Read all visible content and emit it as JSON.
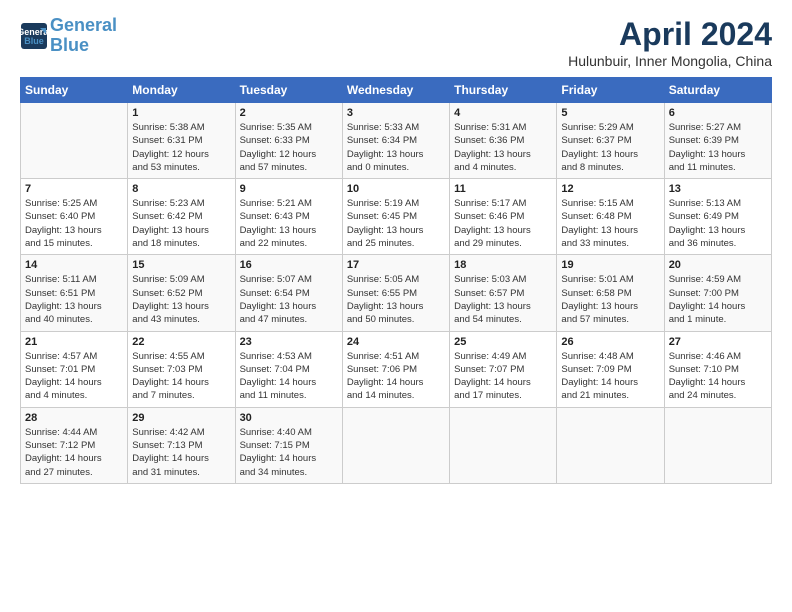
{
  "header": {
    "logo_line1": "General",
    "logo_line2": "Blue",
    "title": "April 2024",
    "location": "Hulunbuir, Inner Mongolia, China"
  },
  "columns": [
    "Sunday",
    "Monday",
    "Tuesday",
    "Wednesday",
    "Thursday",
    "Friday",
    "Saturday"
  ],
  "weeks": [
    [
      {
        "day": "",
        "info": ""
      },
      {
        "day": "1",
        "info": "Sunrise: 5:38 AM\nSunset: 6:31 PM\nDaylight: 12 hours\nand 53 minutes."
      },
      {
        "day": "2",
        "info": "Sunrise: 5:35 AM\nSunset: 6:33 PM\nDaylight: 12 hours\nand 57 minutes."
      },
      {
        "day": "3",
        "info": "Sunrise: 5:33 AM\nSunset: 6:34 PM\nDaylight: 13 hours\nand 0 minutes."
      },
      {
        "day": "4",
        "info": "Sunrise: 5:31 AM\nSunset: 6:36 PM\nDaylight: 13 hours\nand 4 minutes."
      },
      {
        "day": "5",
        "info": "Sunrise: 5:29 AM\nSunset: 6:37 PM\nDaylight: 13 hours\nand 8 minutes."
      },
      {
        "day": "6",
        "info": "Sunrise: 5:27 AM\nSunset: 6:39 PM\nDaylight: 13 hours\nand 11 minutes."
      }
    ],
    [
      {
        "day": "7",
        "info": "Sunrise: 5:25 AM\nSunset: 6:40 PM\nDaylight: 13 hours\nand 15 minutes."
      },
      {
        "day": "8",
        "info": "Sunrise: 5:23 AM\nSunset: 6:42 PM\nDaylight: 13 hours\nand 18 minutes."
      },
      {
        "day": "9",
        "info": "Sunrise: 5:21 AM\nSunset: 6:43 PM\nDaylight: 13 hours\nand 22 minutes."
      },
      {
        "day": "10",
        "info": "Sunrise: 5:19 AM\nSunset: 6:45 PM\nDaylight: 13 hours\nand 25 minutes."
      },
      {
        "day": "11",
        "info": "Sunrise: 5:17 AM\nSunset: 6:46 PM\nDaylight: 13 hours\nand 29 minutes."
      },
      {
        "day": "12",
        "info": "Sunrise: 5:15 AM\nSunset: 6:48 PM\nDaylight: 13 hours\nand 33 minutes."
      },
      {
        "day": "13",
        "info": "Sunrise: 5:13 AM\nSunset: 6:49 PM\nDaylight: 13 hours\nand 36 minutes."
      }
    ],
    [
      {
        "day": "14",
        "info": "Sunrise: 5:11 AM\nSunset: 6:51 PM\nDaylight: 13 hours\nand 40 minutes."
      },
      {
        "day": "15",
        "info": "Sunrise: 5:09 AM\nSunset: 6:52 PM\nDaylight: 13 hours\nand 43 minutes."
      },
      {
        "day": "16",
        "info": "Sunrise: 5:07 AM\nSunset: 6:54 PM\nDaylight: 13 hours\nand 47 minutes."
      },
      {
        "day": "17",
        "info": "Sunrise: 5:05 AM\nSunset: 6:55 PM\nDaylight: 13 hours\nand 50 minutes."
      },
      {
        "day": "18",
        "info": "Sunrise: 5:03 AM\nSunset: 6:57 PM\nDaylight: 13 hours\nand 54 minutes."
      },
      {
        "day": "19",
        "info": "Sunrise: 5:01 AM\nSunset: 6:58 PM\nDaylight: 13 hours\nand 57 minutes."
      },
      {
        "day": "20",
        "info": "Sunrise: 4:59 AM\nSunset: 7:00 PM\nDaylight: 14 hours\nand 1 minute."
      }
    ],
    [
      {
        "day": "21",
        "info": "Sunrise: 4:57 AM\nSunset: 7:01 PM\nDaylight: 14 hours\nand 4 minutes."
      },
      {
        "day": "22",
        "info": "Sunrise: 4:55 AM\nSunset: 7:03 PM\nDaylight: 14 hours\nand 7 minutes."
      },
      {
        "day": "23",
        "info": "Sunrise: 4:53 AM\nSunset: 7:04 PM\nDaylight: 14 hours\nand 11 minutes."
      },
      {
        "day": "24",
        "info": "Sunrise: 4:51 AM\nSunset: 7:06 PM\nDaylight: 14 hours\nand 14 minutes."
      },
      {
        "day": "25",
        "info": "Sunrise: 4:49 AM\nSunset: 7:07 PM\nDaylight: 14 hours\nand 17 minutes."
      },
      {
        "day": "26",
        "info": "Sunrise: 4:48 AM\nSunset: 7:09 PM\nDaylight: 14 hours\nand 21 minutes."
      },
      {
        "day": "27",
        "info": "Sunrise: 4:46 AM\nSunset: 7:10 PM\nDaylight: 14 hours\nand 24 minutes."
      }
    ],
    [
      {
        "day": "28",
        "info": "Sunrise: 4:44 AM\nSunset: 7:12 PM\nDaylight: 14 hours\nand 27 minutes."
      },
      {
        "day": "29",
        "info": "Sunrise: 4:42 AM\nSunset: 7:13 PM\nDaylight: 14 hours\nand 31 minutes."
      },
      {
        "day": "30",
        "info": "Sunrise: 4:40 AM\nSunset: 7:15 PM\nDaylight: 14 hours\nand 34 minutes."
      },
      {
        "day": "",
        "info": ""
      },
      {
        "day": "",
        "info": ""
      },
      {
        "day": "",
        "info": ""
      },
      {
        "day": "",
        "info": ""
      }
    ]
  ]
}
